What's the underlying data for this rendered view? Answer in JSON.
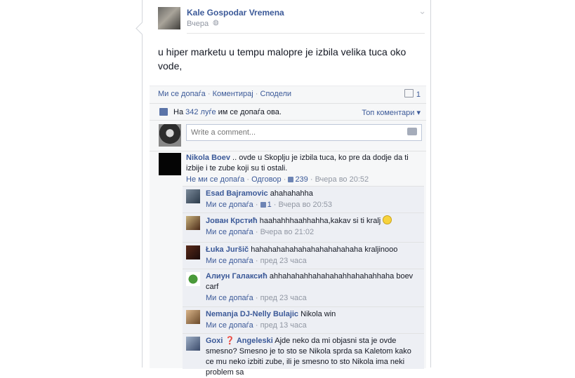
{
  "post": {
    "author": "Kale Gospodar Vremena",
    "time": "Вчера",
    "text": "u hiper marketu u tempu malopre je izbila velika tuca oko vode,",
    "actions": {
      "like": "Ми се допаѓа",
      "comment": "Коментирај",
      "share": "Сподели"
    },
    "comment_count": "1",
    "likes_prefix": "На ",
    "likes_link": "342 луѓе",
    "likes_suffix": " им се допаѓа ова.",
    "top_comments": "Топ коментари ▾",
    "write_placeholder": "Write a comment...",
    "icons": {
      "globe": "globe-icon",
      "chevron": "chevron-down-icon",
      "camera": "camera-icon",
      "like": "thumbs-up-icon"
    }
  },
  "comment": {
    "name": "Nikola Boev",
    "text": ".. ovde u Skoplju je izbila tuca, ko pre da dodje da ti izbije i te zube koji su ti ostali.",
    "unlike": "Не ми се допаѓа",
    "reply": "Одговор",
    "likes": "239",
    "time": "Вчера во 20:52"
  },
  "replies": [
    {
      "name": "Esad Bajramovic",
      "text": "ahahahahha",
      "like": "Ми се допаѓа",
      "likes": "1",
      "time": "Вчера во 20:53"
    },
    {
      "name": "Јован Крстић",
      "text": "haahahhhaahhahha,kakav si ti kralj",
      "like": "Ми се допаѓа",
      "time": "Вчера во 21:02"
    },
    {
      "name": "Łuka Juršič",
      "text": "hahahahahahahahahahahahaha kraljinooo",
      "like": "Ми се допаѓа",
      "time": "пред 23 часа"
    },
    {
      "name": "Алиун Галаксић",
      "text": "ahhahahahhahahahahhahahahhaha boev carf",
      "like": "Ми се допаѓа",
      "time": "пред 23 часа"
    },
    {
      "name": "Nemanja DJ-Nelly Bulajic",
      "text": "Nikola win",
      "like": "Ми се допаѓа",
      "time": "пред 13 часа"
    },
    {
      "name": "Goxi ❓ Angeleski",
      "text": "Ajde neko da mi objasni sta je ovde smesno? Smesno je to sto se Nikola sprda sa Kaletom kako ce mu neko izbiti zube, ili je smesno to sto Nikola ima neki problem sa"
    }
  ]
}
